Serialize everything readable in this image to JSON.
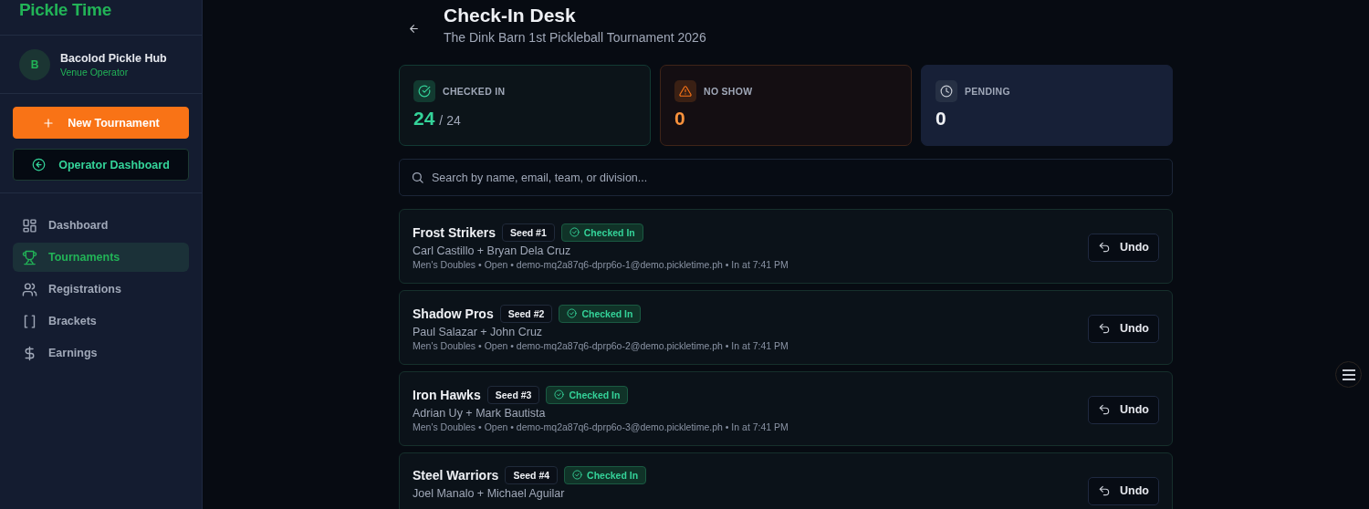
{
  "sidebar": {
    "logo": "Pickle Time",
    "profile": {
      "initial": "B",
      "name": "Bacolod Pickle Hub",
      "role": "Venue Operator"
    },
    "buttons": [
      {
        "kind": "primary",
        "label": "New Tournament"
      },
      {
        "kind": "secondary",
        "label": "Operator Dashboard"
      }
    ],
    "items": [
      {
        "kind": "dashboard",
        "label": "Dashboard",
        "selected": false
      },
      {
        "kind": "trophy",
        "label": "Tournaments",
        "selected": true
      },
      {
        "kind": "users",
        "label": "Registrations",
        "selected": false
      },
      {
        "kind": "brackets",
        "label": "Brackets",
        "selected": false
      },
      {
        "kind": "dollar",
        "label": "Earnings",
        "selected": false
      }
    ]
  },
  "header": {
    "title": "Check-In Desk",
    "subtitle": "The Dink Barn 1st Pickleball Tournament 2026"
  },
  "stats": [
    {
      "kind": "checked",
      "label": "CHECKED IN",
      "value": "24",
      "total": "/ 24"
    },
    {
      "kind": "noshow",
      "label": "NO SHOW",
      "value": "0"
    },
    {
      "kind": "pending",
      "label": "PENDING",
      "value": "0"
    }
  ],
  "search": {
    "placeholder": "Search by name, email, team, or division..."
  },
  "rows": [
    {
      "team": "Frost Strikers",
      "seed": "Seed #1",
      "status": "Checked In",
      "checked_in": true,
      "players": "Carl Castillo + Bryan Dela Cruz",
      "meta": "Men's Doubles • Open • demo-mq2a87q6-dprp6o-1@demo.pickletime.ph • In at 7:41 PM",
      "action": "Undo"
    },
    {
      "team": "Shadow Pros",
      "seed": "Seed #2",
      "status": "Checked In",
      "checked_in": true,
      "players": "Paul Salazar + John Cruz",
      "meta": "Men's Doubles • Open • demo-mq2a87q6-dprp6o-2@demo.pickletime.ph • In at 7:41 PM",
      "action": "Undo"
    },
    {
      "team": "Iron Hawks",
      "seed": "Seed #3",
      "status": "Checked In",
      "checked_in": true,
      "players": "Adrian Uy + Mark Bautista",
      "meta": "Men's Doubles • Open • demo-mq2a87q6-dprp6o-3@demo.pickletime.ph • In at 7:41 PM",
      "action": "Undo"
    },
    {
      "team": "Steel Warriors",
      "seed": "Seed #4",
      "status": "Checked In",
      "checked_in": true,
      "players": "Joel Manalo + Michael Aguilar",
      "action": "Undo"
    }
  ]
}
